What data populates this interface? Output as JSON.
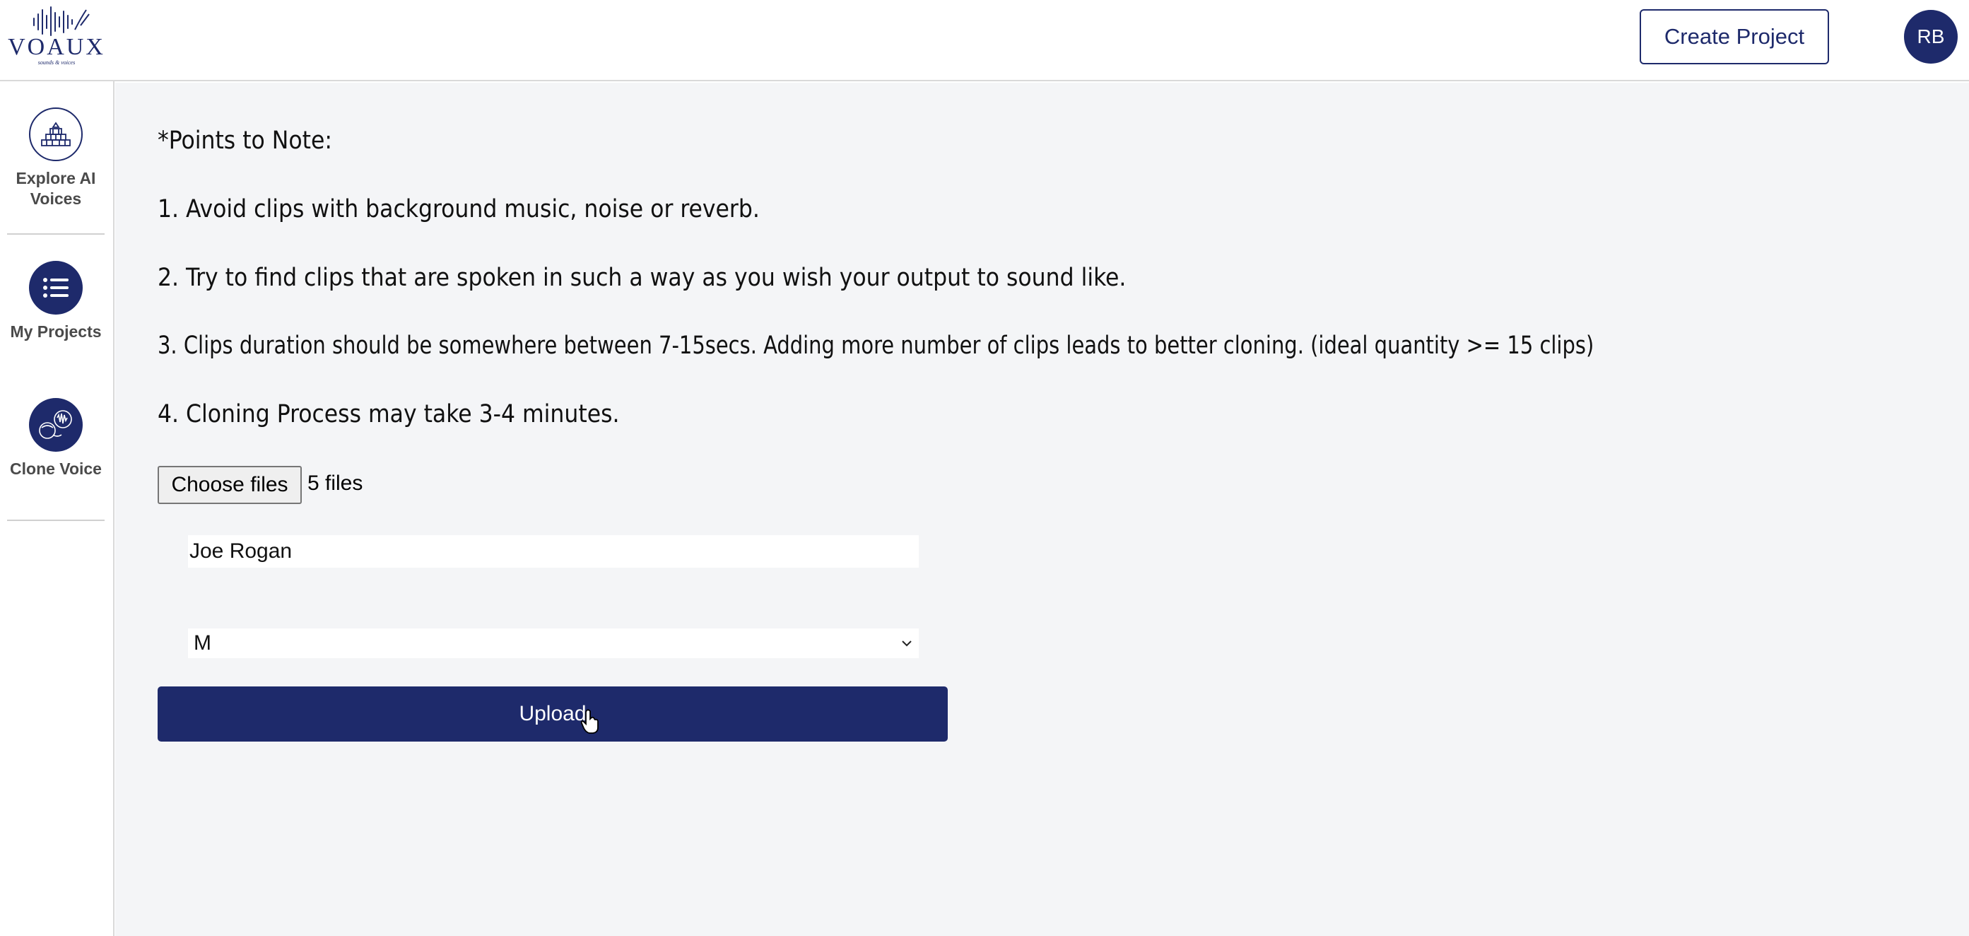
{
  "header": {
    "logo_text": "VOAUX",
    "logo_tagline": "sounds & voices",
    "create_button": "Create Project",
    "avatar_initials": "RB"
  },
  "sidebar": {
    "items": [
      {
        "label": "Explore AI Voices",
        "icon": "building-icon"
      },
      {
        "label": "My Projects",
        "icon": "list-icon"
      },
      {
        "label": "Clone Voice",
        "icon": "clone-voice-icon"
      }
    ]
  },
  "notes": {
    "heading": "*Points to Note:",
    "items": [
      "1. Avoid clips with background music, noise or reverb.",
      "2. Try to find clips that are spoken in such a way as you wish your output to sound like.",
      "3. Clips duration should be somewhere between 7-15secs. Adding more number of clips leads to better cloning. (ideal quantity >= 15 clips)",
      "4. Cloning Process may take 3-4 minutes."
    ]
  },
  "form": {
    "file_button": "Choose files",
    "file_status": "5 files",
    "name_value": "Joe Rogan",
    "gender_selected": "M",
    "upload_button": "Upload"
  },
  "colors": {
    "brand": "#1e2a6b",
    "background": "#f4f5f7"
  }
}
